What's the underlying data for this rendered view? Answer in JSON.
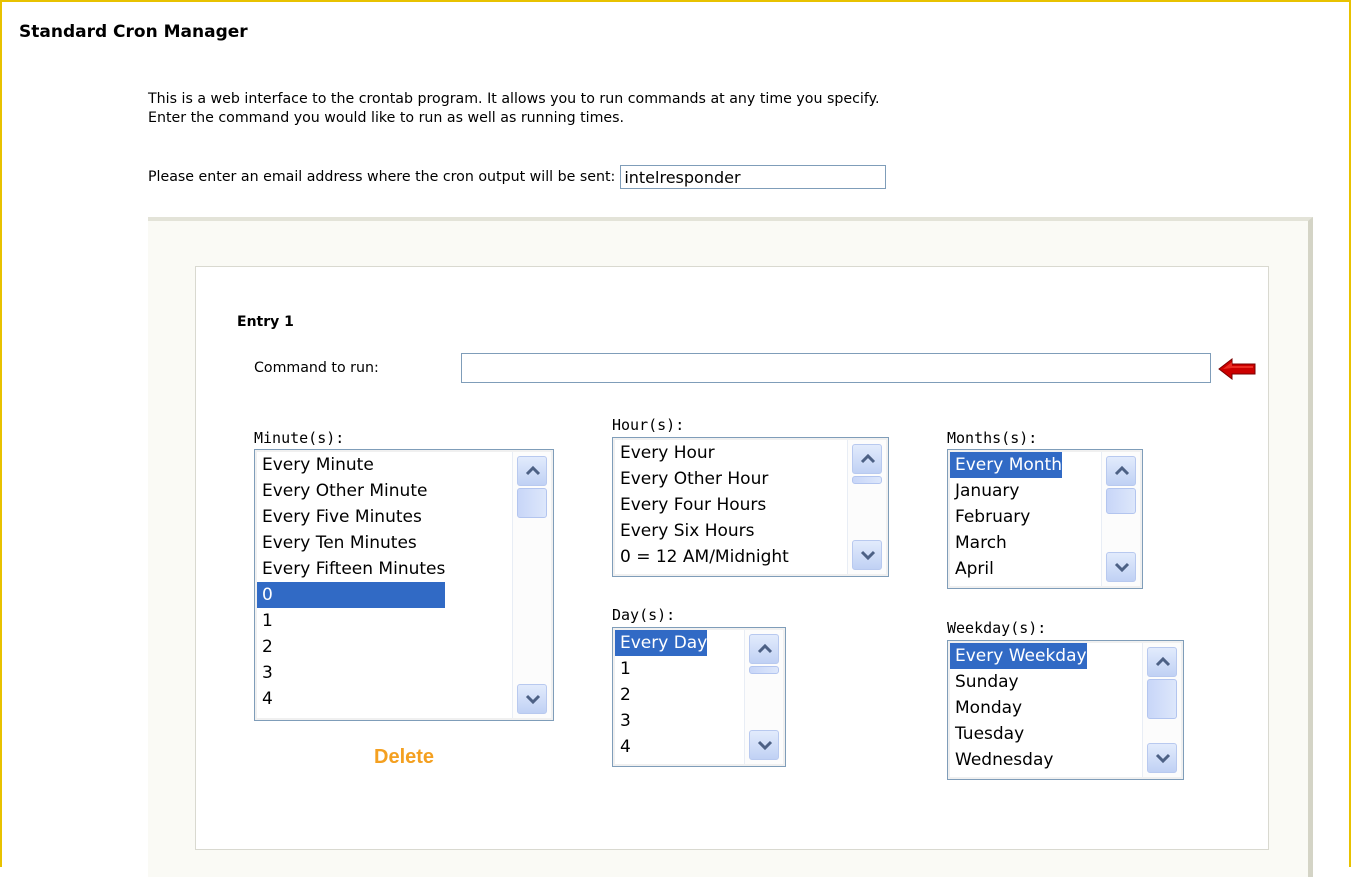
{
  "page": {
    "title": "Standard Cron Manager",
    "intro_line1": "This is a web interface to the crontab program. It allows you to run commands at any time you specify.",
    "intro_line2": "Enter the command you would like to run as well as running times.",
    "email_label": "Please enter an email address where the cron output will be sent:",
    "email_value": "intelresponder"
  },
  "entry": {
    "title": "Entry 1",
    "command_label": "Command to run:",
    "command_value": "",
    "delete_label": "Delete",
    "minutes": {
      "label": "Minute(s):",
      "options": [
        "Every Minute",
        "Every Other Minute",
        "Every Five Minutes",
        "Every Ten Minutes",
        "Every Fifteen Minutes",
        "0",
        "1",
        "2",
        "3",
        "4"
      ],
      "selected": "0"
    },
    "hours": {
      "label": "Hour(s):",
      "options": [
        "Every Hour",
        "Every Other Hour",
        "Every Four Hours",
        "Every Six Hours",
        "0 = 12 AM/Midnight"
      ],
      "selected": ""
    },
    "days": {
      "label": "Day(s):",
      "options": [
        "Every Day",
        "1",
        "2",
        "3",
        "4"
      ],
      "selected": "Every Day"
    },
    "months": {
      "label": "Months(s):",
      "options": [
        "Every Month",
        "January",
        "February",
        "March",
        "April"
      ],
      "selected": "Every Month"
    },
    "weekdays": {
      "label": "Weekday(s):",
      "options": [
        "Every Weekday",
        "Sunday",
        "Monday",
        "Tuesday",
        "Wednesday"
      ],
      "selected": "Every Weekday"
    }
  },
  "icons": {
    "command_pointer": "red-left-arrow-icon",
    "scroll_up": "chevron-up-icon",
    "scroll_down": "chevron-down-icon"
  },
  "colors": {
    "selection": "#316ac5",
    "delete_link": "#f4a020",
    "pointer_arrow": "#cc0000",
    "frame_border": "#e8c200"
  }
}
